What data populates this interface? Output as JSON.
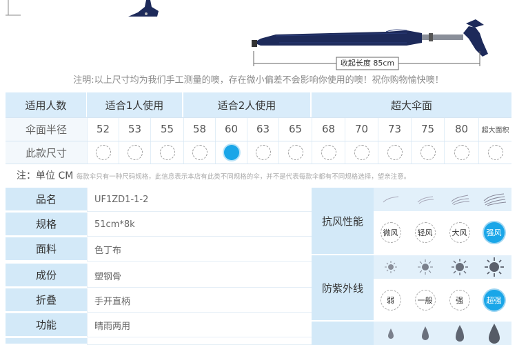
{
  "header": {
    "folded_length_label": "收起长度 85cm",
    "measure_note": "注明:以上尺寸均为我们手工测量的噢，存在微小偏差不会影响你使用的噢！祝你购物愉快噢！"
  },
  "size_table": {
    "row_labels": [
      "适用人数",
      "伞面半径",
      "此款尺寸"
    ],
    "groups": [
      "适合1人使用",
      "适合2人使用",
      "超大伞面"
    ],
    "radii": [
      "52",
      "53",
      "55",
      "58",
      "60",
      "63",
      "65",
      "68",
      "70",
      "73",
      "75",
      "80",
      "超大面积"
    ],
    "selected_radius": "60"
  },
  "unit_note": {
    "main": "注：单位 CM",
    "detail": "每款伞只有一种尺码规格，此信息表示本店有此类不同规格的伞，并不是代表每款伞都有不同规格选择，望亲注意。"
  },
  "specs": [
    {
      "label": "品名",
      "value": "UF1ZD1-1-2"
    },
    {
      "label": "规格",
      "value": "51cm*8k"
    },
    {
      "label": "面料",
      "value": "色丁布"
    },
    {
      "label": "成份",
      "value": "塑钢骨"
    },
    {
      "label": "折叠",
      "value": "手开直柄"
    },
    {
      "label": "功能",
      "value": "晴雨两用"
    },
    {
      "label": "",
      "value": ""
    }
  ],
  "wind": {
    "title": "抗风性能",
    "levels": [
      "微风",
      "轻风",
      "大风",
      "强风"
    ],
    "selected": "强风"
  },
  "uv": {
    "title": "防紫外线",
    "levels": [
      "弱",
      "一般",
      "强",
      "超强"
    ],
    "selected": "超强"
  },
  "colors": {
    "accent": "#1aa6e8",
    "header_bg": "#d9ecfa",
    "umbrella": "#1d2a5a"
  }
}
